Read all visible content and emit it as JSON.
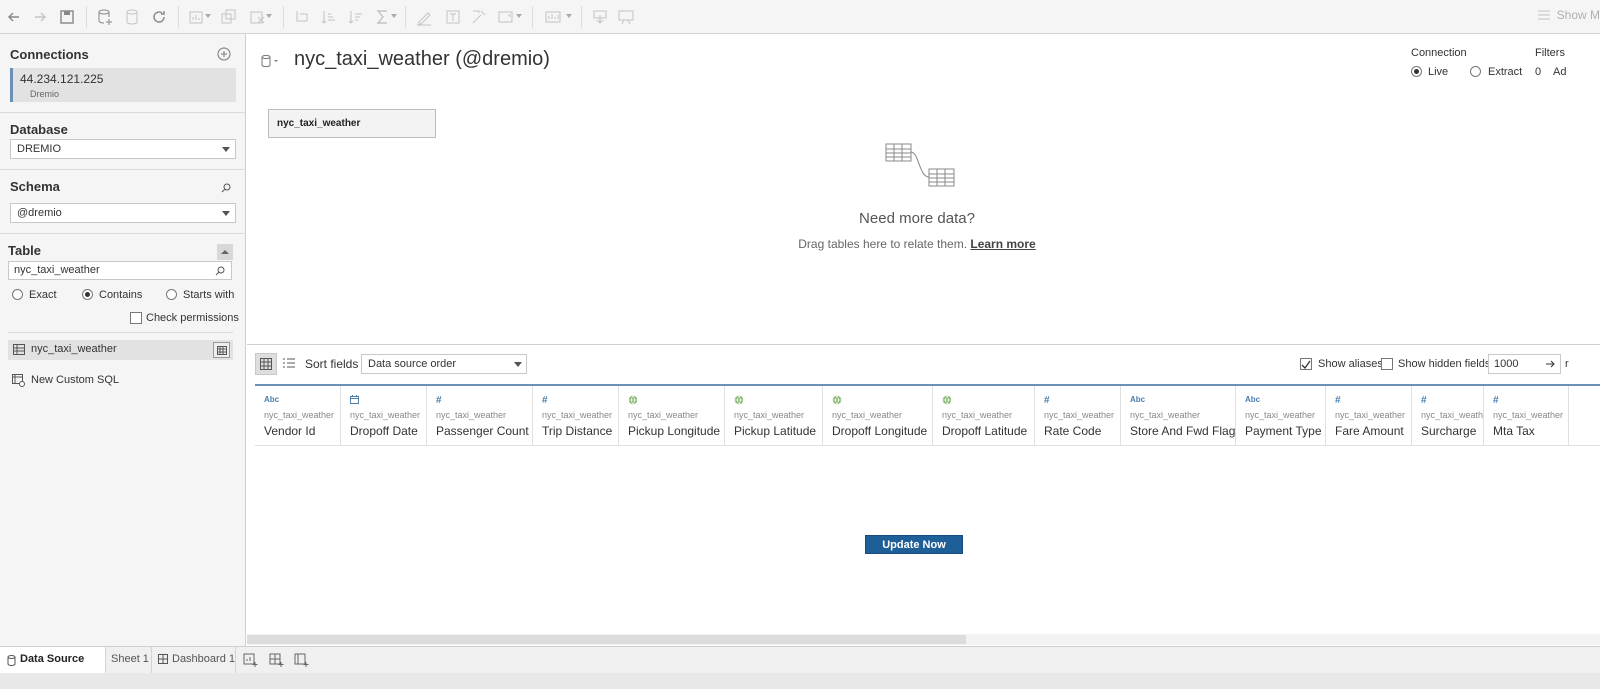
{
  "toolbar": {
    "show_me_label": "Show M"
  },
  "left": {
    "connections_title": "Connections",
    "connection_host": "44.234.121.225",
    "connection_type": "Dremio",
    "database_title": "Database",
    "database_value": "DREMIO",
    "schema_title": "Schema",
    "schema_value": "@dremio",
    "table_title": "Table",
    "table_search_value": "nyc_taxi_weather",
    "match_options": [
      "Exact",
      "Contains",
      "Starts with"
    ],
    "match_selected": "Contains",
    "check_permissions_label": "Check permissions",
    "table_item": "nyc_taxi_weather",
    "custom_sql_label": "New Custom SQL"
  },
  "main": {
    "title": "nyc_taxi_weather (@dremio)",
    "connection_label": "Connection",
    "live_label": "Live",
    "extract_label": "Extract",
    "filters_label": "Filters",
    "filters_count": "0",
    "filters_add": "Ad",
    "table_box": "nyc_taxi_weather",
    "need_more_title": "Need more data?",
    "need_more_text": "Drag tables here to relate them.",
    "learn_more": "Learn more",
    "sort_label": "Sort fields",
    "sort_value": "Data source order",
    "show_aliases_label": "Show aliases",
    "show_hidden_label": "Show hidden fields",
    "rows_value": "1000",
    "rows_suffix": "r",
    "update_now_label": "Update Now"
  },
  "columns": [
    {
      "type": "Abc",
      "source": "nyc_taxi_weather",
      "name": "Vendor Id"
    },
    {
      "type": "calendar",
      "source": "nyc_taxi_weather",
      "name": "Dropoff Date"
    },
    {
      "type": "#",
      "source": "nyc_taxi_weather",
      "name": "Passenger Count"
    },
    {
      "type": "#",
      "source": "nyc_taxi_weather",
      "name": "Trip Distance"
    },
    {
      "type": "globe",
      "source": "nyc_taxi_weather",
      "name": "Pickup Longitude"
    },
    {
      "type": "globe",
      "source": "nyc_taxi_weather",
      "name": "Pickup Latitude"
    },
    {
      "type": "globe",
      "source": "nyc_taxi_weather",
      "name": "Dropoff Longitude"
    },
    {
      "type": "globe",
      "source": "nyc_taxi_weather",
      "name": "Dropoff Latitude"
    },
    {
      "type": "#",
      "source": "nyc_taxi_weather",
      "name": "Rate Code"
    },
    {
      "type": "Abc",
      "source": "nyc_taxi_weather",
      "name": "Store And Fwd Flag"
    },
    {
      "type": "Abc",
      "source": "nyc_taxi_weather",
      "name": "Payment Type"
    },
    {
      "type": "#",
      "source": "nyc_taxi_weather",
      "name": "Fare Amount"
    },
    {
      "type": "#",
      "source": "nyc_taxi_weather",
      "name": "Surcharge"
    },
    {
      "type": "#",
      "source": "nyc_taxi_weather",
      "name": "Mta Tax"
    }
  ],
  "bottom_tabs": [
    "Data Source",
    "Sheet 1",
    "Dashboard 1"
  ],
  "colors": {
    "accent": "#1f5f98",
    "selection_bar": "#6b8fb5",
    "field_icon": "#4a7fae"
  }
}
